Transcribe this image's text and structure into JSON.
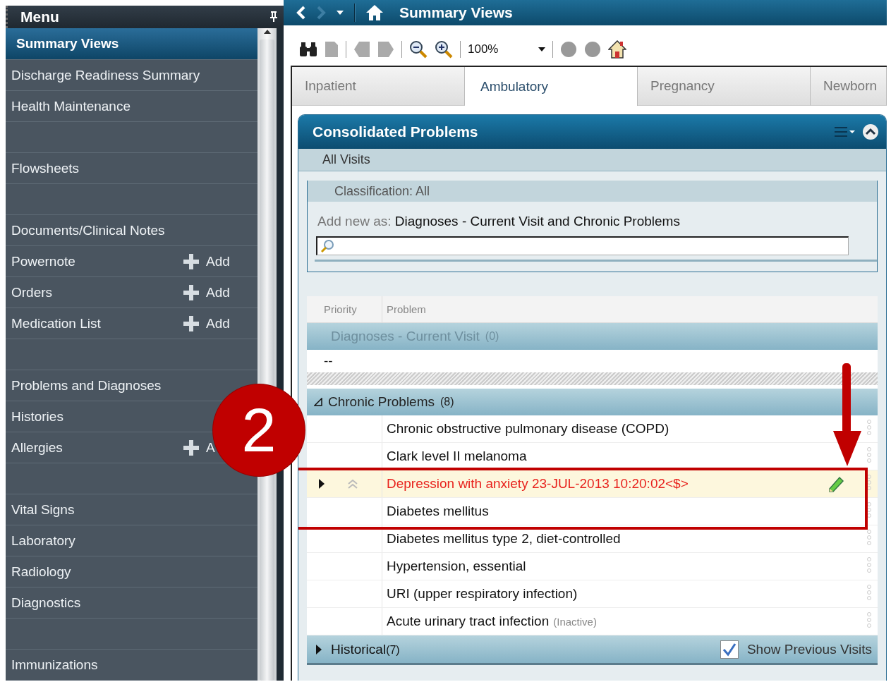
{
  "sidebar": {
    "title": "Menu",
    "items": [
      {
        "kind": "item",
        "label": "Summary Views",
        "selected": true
      },
      {
        "kind": "item",
        "label": "Discharge Readiness Summary",
        "selected": false
      },
      {
        "kind": "item",
        "label": "Health Maintenance",
        "selected": false
      },
      {
        "kind": "spacer"
      },
      {
        "kind": "item",
        "label": "Flowsheets",
        "selected": false
      },
      {
        "kind": "spacer"
      },
      {
        "kind": "item",
        "label": "Documents/Clinical Notes",
        "selected": false
      },
      {
        "kind": "item",
        "label": "Powernote",
        "action": "Add",
        "selected": false
      },
      {
        "kind": "item",
        "label": "Orders",
        "action": "Add",
        "selected": false
      },
      {
        "kind": "item",
        "label": "Medication List",
        "action": "Add",
        "selected": false
      },
      {
        "kind": "spacer"
      },
      {
        "kind": "item",
        "label": "Problems and Diagnoses",
        "selected": false
      },
      {
        "kind": "item",
        "label": "Histories",
        "selected": false
      },
      {
        "kind": "item",
        "label": "Allergies",
        "action": "A",
        "selected": false
      },
      {
        "kind": "spacer"
      },
      {
        "kind": "item",
        "label": "Vital Signs",
        "selected": false
      },
      {
        "kind": "item",
        "label": "Laboratory",
        "selected": false
      },
      {
        "kind": "item",
        "label": "Radiology",
        "selected": false
      },
      {
        "kind": "item",
        "label": "Diagnostics",
        "selected": false
      },
      {
        "kind": "spacer"
      },
      {
        "kind": "item",
        "label": "Immunizations",
        "selected": false
      }
    ]
  },
  "nav": {
    "title": "Summary Views"
  },
  "toolbar": {
    "zoom": "100%"
  },
  "tabs": [
    {
      "label": "Inpatient",
      "selected": false
    },
    {
      "label": "Ambulatory",
      "selected": true
    },
    {
      "label": "Pregnancy",
      "selected": false
    },
    {
      "label": "Newborn",
      "selected": false
    }
  ],
  "panel": {
    "title": "Consolidated Problems",
    "filter": "All Visits",
    "classification": "Classification: All",
    "add_label": "Add new as:",
    "add_value": "Diagnoses - Current Visit and Chronic Problems",
    "columns": [
      "Priority",
      "Problem"
    ],
    "current_visit": {
      "label": "Diagnoses - Current Visit",
      "count": "(0)",
      "empty": "--"
    },
    "chronic": {
      "label": "Chronic Problems",
      "count": "(8)",
      "expanded": true,
      "rows": [
        {
          "problem": "Chronic obstructive pulmonary disease (COPD)",
          "selected": false
        },
        {
          "problem": "Clark level II melanoma",
          "selected": false
        },
        {
          "problem": "Depression with anxiety 23-JUL-2013 10:20:02<$>",
          "selected": true
        },
        {
          "problem": "Diabetes mellitus",
          "selected": false
        },
        {
          "problem": "Diabetes mellitus type 2, diet-controlled",
          "selected": false
        },
        {
          "problem": "Hypertension, essential",
          "selected": false
        },
        {
          "problem": "URI (upper respiratory infection)",
          "selected": false
        },
        {
          "problem": "Acute urinary tract infection",
          "status": "(Inactive)",
          "selected": false
        }
      ]
    },
    "historical": {
      "label": "Historical",
      "count": "(7)",
      "expanded": false
    },
    "show_previous": {
      "label": "Show Previous Visits",
      "checked": true
    }
  },
  "annotation": {
    "step": "2"
  }
}
